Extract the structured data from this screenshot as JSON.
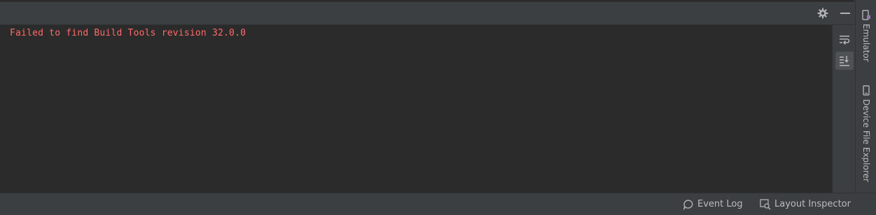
{
  "header": {
    "settings_icon": "gear-icon",
    "hide_icon": "minimize-icon"
  },
  "console": {
    "lines": [
      "Failed to find Build Tools revision 32.0.0"
    ],
    "error_color": "#ff6b68"
  },
  "side_tools": {
    "soft_wrap_icon": "soft-wrap-icon",
    "scroll_to_end_icon": "scroll-to-end-icon",
    "scroll_to_end_active": true
  },
  "right_bar": {
    "tabs": [
      {
        "label": "Emulator",
        "icon": "emulator-icon"
      },
      {
        "label": "Device File Explorer",
        "icon": "device-icon"
      }
    ]
  },
  "statusbar": {
    "event_log": "Event Log",
    "layout_inspector": "Layout Inspector"
  }
}
